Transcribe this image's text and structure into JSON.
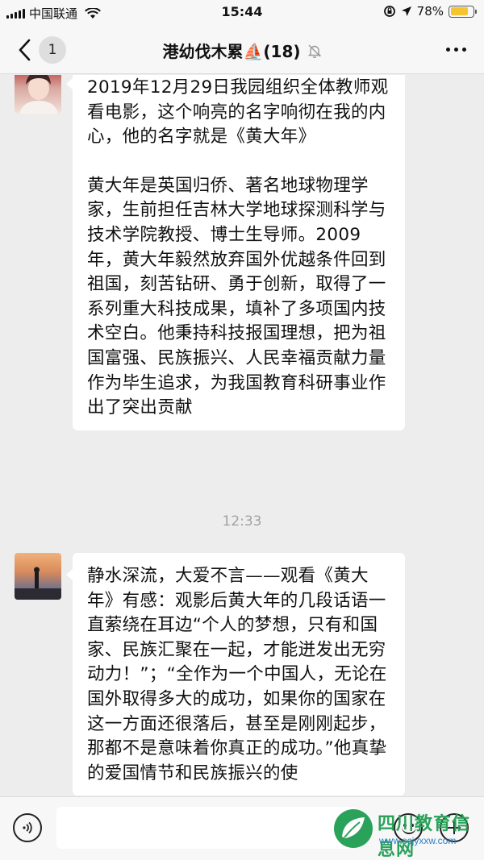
{
  "status_bar": {
    "carrier": "中国联通",
    "time": "15:44",
    "battery_percent": "78%",
    "battery_level": 0.78,
    "battery_color": "#f4c431"
  },
  "nav": {
    "back_count": "1",
    "title": "港幼伐木累⛵(18)",
    "mute_icon": "bell-slash-icon",
    "more_icon": "ellipsis-icon"
  },
  "messages": [
    {
      "paragraphs": [
        "2019年12月29日我园组织全体教师观看电影，这个响亮的名字响彻在我的内心，他的名字就是《黄大年》",
        "黄大年是英国归侨、著名地球物理学家，生前担任吉林大学地球探测科学与技术学院教授、博士生导师。2009年，黄大年毅然放弃国外优越条件回到祖国，刻苦钻研、勇于创新，取得了一系列重大科技成果，填补了多项国内技术空白。他秉持科技报国理想，把为祖国富强、民族振兴、人民幸福贡献力量作为毕生追求，为我国教育科研事业作出了突出贡献"
      ]
    },
    {
      "paragraphs": [
        "静水深流，大爱不言——观看《黄大年》有感：观影后黄大年的几段话语一直萦绕在耳边“个人的梦想，只有和国家、民族汇聚在一起，才能迸发出无穷动力！”；“全作为一个中国人，无论在国外取得多大的成功，如果你的国家在这一方面还很落后，甚至是刚刚起步，那都不是意味着你真正的成功。”他真挚的爱国情节和民族振兴的使"
      ]
    }
  ],
  "timestamp": "12:33",
  "input_bar": {
    "voice_icon": "voice-icon",
    "emoji_icon": "emoji-icon",
    "plus_icon": "plus-icon"
  },
  "watermark": {
    "name": "四川教育信息网",
    "url": "www.scjyxxw.com"
  }
}
